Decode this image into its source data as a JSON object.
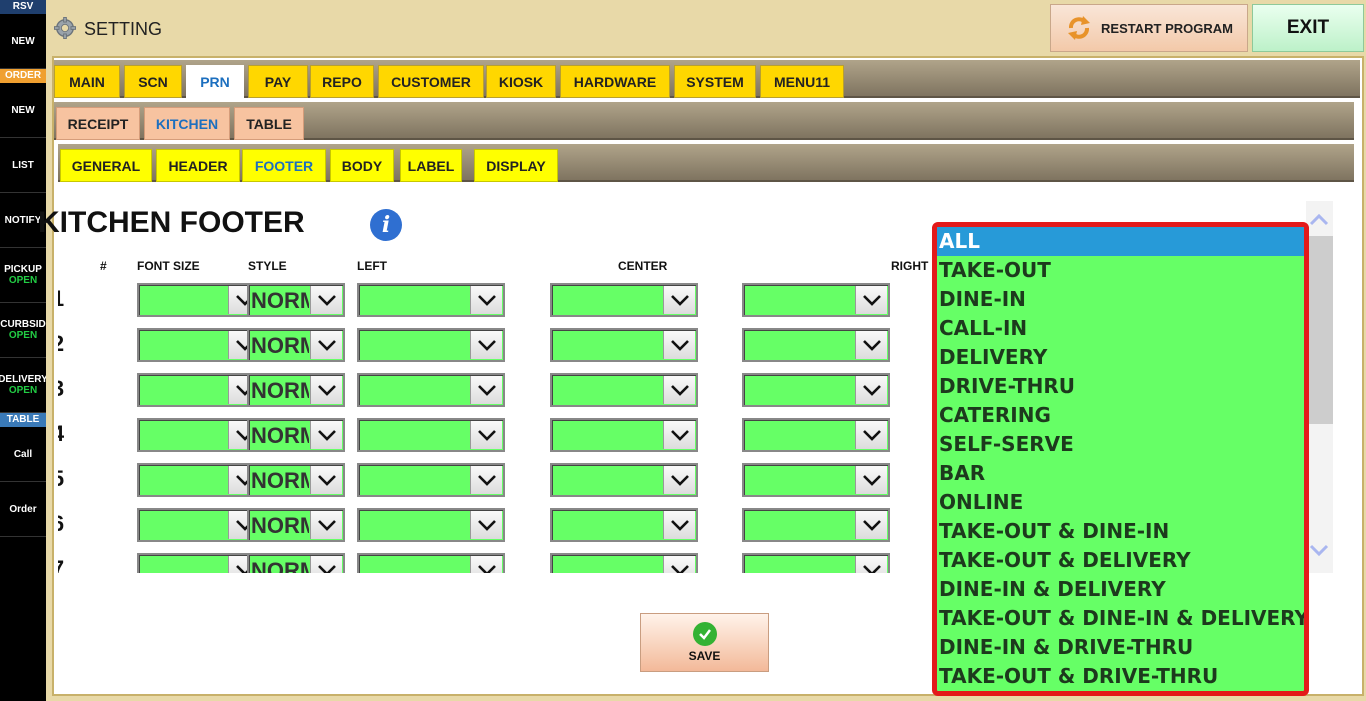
{
  "sidebar": {
    "sections": [
      {
        "header": "RSV",
        "type": "rsv"
      },
      {
        "button": "NEW"
      },
      {
        "header": "ORDER",
        "type": "order"
      },
      {
        "button": "NEW"
      },
      {
        "button": "LIST"
      },
      {
        "button": "NOTIFY"
      },
      {
        "button": "PICKUP",
        "sub": "OPEN"
      },
      {
        "button": "CURBSID",
        "sub": "OPEN"
      },
      {
        "button": "DELIVERY",
        "sub": "OPEN"
      },
      {
        "header": "TABLE",
        "type": "table"
      },
      {
        "button": "Call"
      },
      {
        "button": "Order"
      }
    ]
  },
  "titlebar": {
    "title": "SETTING",
    "restart_label": "RESTART PROGRAM",
    "exit_label": "EXIT"
  },
  "tabs_main": [
    "MAIN",
    "SCN",
    "PRN",
    "PAY",
    "REPO",
    "CUSTOMER",
    "KIOSK",
    "HARDWARE",
    "SYSTEM",
    "MENU11"
  ],
  "tabs_main_active": "PRN",
  "tabs_prn": [
    "RECEIPT",
    "KITCHEN",
    "TABLE"
  ],
  "tabs_prn_active": "KITCHEN",
  "tabs_kitchen": [
    "GENERAL",
    "HEADER",
    "FOOTER",
    "BODY",
    "LABEL",
    "DISPLAY"
  ],
  "tabs_kitchen_active": "FOOTER",
  "page": {
    "title": "KITCHEN FOOTER",
    "info_glyph": "i"
  },
  "columns": {
    "num": "#",
    "font_size": "FONT SIZE",
    "style": "STYLE",
    "left": "LEFT",
    "center": "CENTER",
    "right": "RIGHT"
  },
  "rows": [
    {
      "num": "1",
      "font_size": "",
      "style": "NORMAL",
      "left": "",
      "center": "",
      "right": ""
    },
    {
      "num": "2",
      "font_size": "",
      "style": "NORMAL",
      "left": "",
      "center": "",
      "right": ""
    },
    {
      "num": "3",
      "font_size": "",
      "style": "NORMAL",
      "left": "",
      "center": "",
      "right": ""
    },
    {
      "num": "4",
      "font_size": "",
      "style": "NORMAL",
      "left": "",
      "center": "",
      "right": ""
    },
    {
      "num": "5",
      "font_size": "",
      "style": "NORMAL",
      "left": "",
      "center": "",
      "right": ""
    },
    {
      "num": "6",
      "font_size": "",
      "style": "NORMAL",
      "left": "",
      "center": "",
      "right": ""
    },
    {
      "num": "7",
      "font_size": "",
      "style": "NORMAL",
      "left": "",
      "center": "",
      "right": ""
    }
  ],
  "save_label": "SAVE",
  "dropdown_options": [
    "ALL",
    "TAKE-OUT",
    "DINE-IN",
    "CALL-IN",
    "DELIVERY",
    "DRIVE-THRU",
    "CATERING",
    "SELF-SERVE",
    "BAR",
    "ONLINE",
    "TAKE-OUT & DINE-IN",
    "TAKE-OUT & DELIVERY",
    "DINE-IN & DELIVERY",
    "TAKE-OUT & DINE-IN & DELIVERY",
    "DINE-IN & DRIVE-THRU",
    "TAKE-OUT & DRIVE-THRU"
  ],
  "dropdown_selected": "ALL",
  "colors": {
    "field_green": "#66ff66",
    "selected_blue": "#279ad8",
    "highlight_red": "#e31a1a",
    "tab_yellow": "#ffd700"
  },
  "icons": {
    "title": "gear-icon",
    "restart": "refresh-icon",
    "info": "info-icon",
    "save": "checkmark-icon",
    "dropdown": "chevron-down-icon",
    "scroll_up": "chevron-up-icon",
    "scroll_down": "chevron-down-icon"
  }
}
